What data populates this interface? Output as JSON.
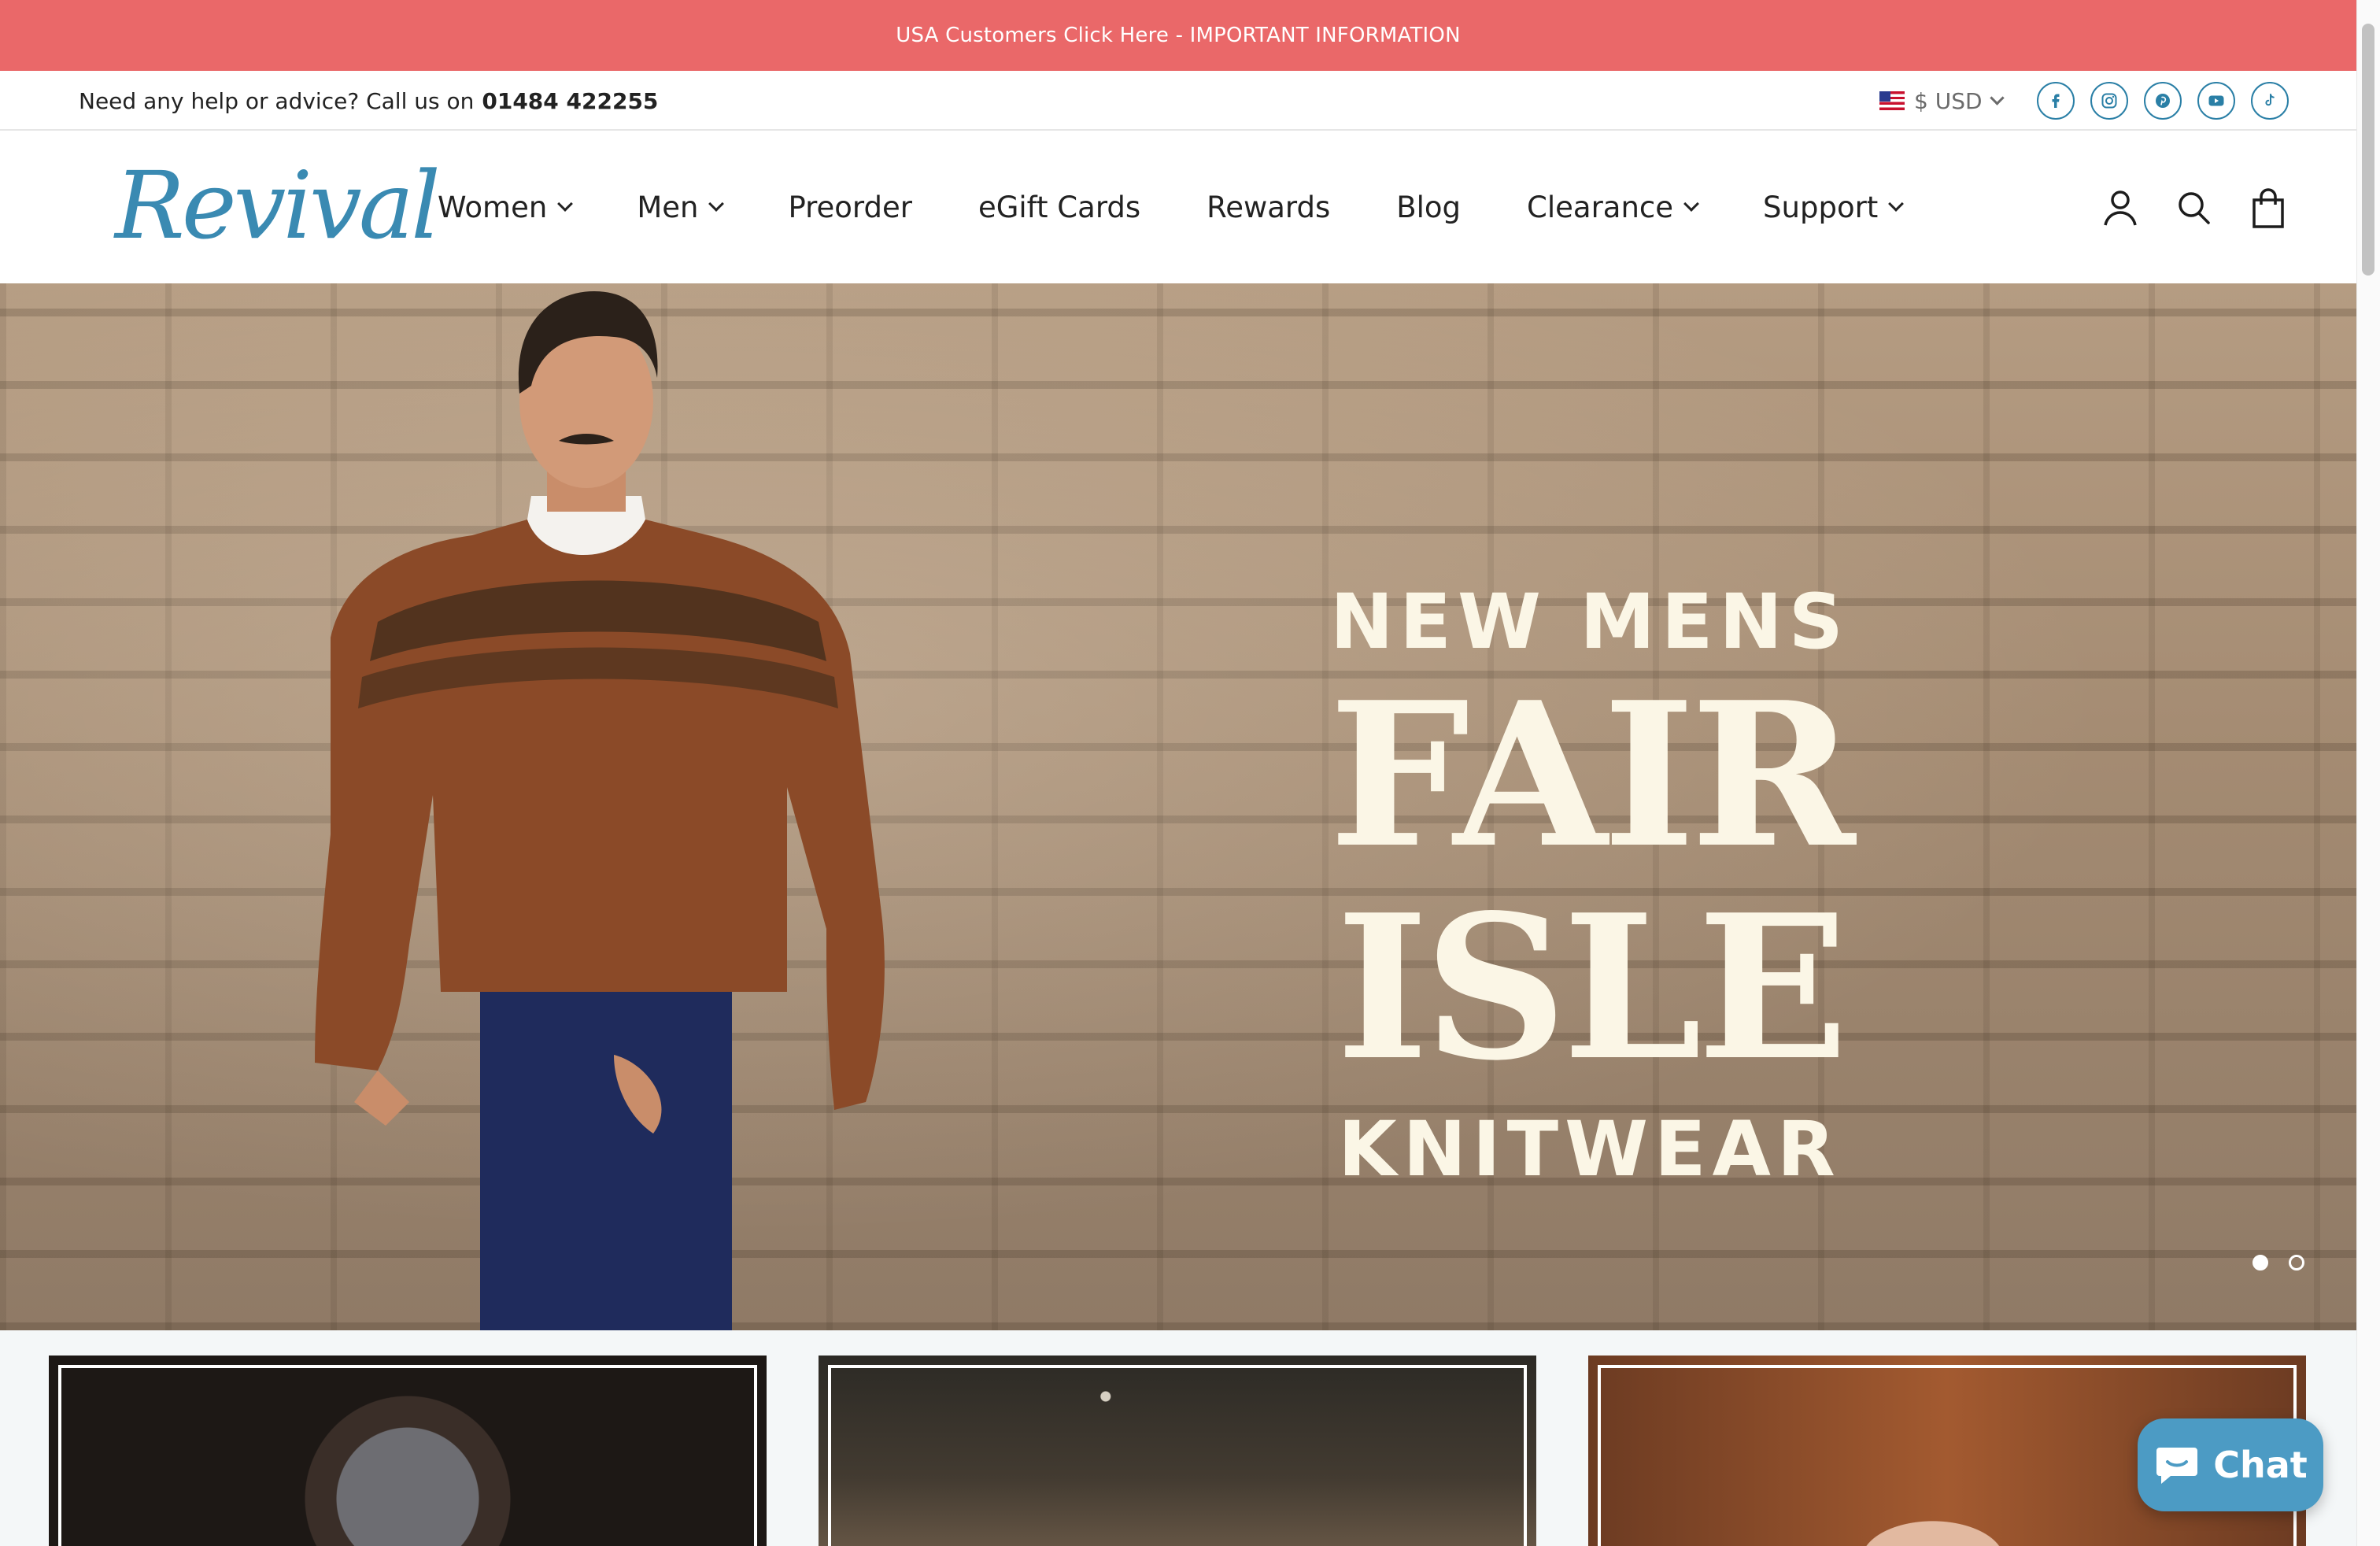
{
  "announcement": {
    "text": "USA Customers Click Here - IMPORTANT INFORMATION"
  },
  "utility_bar": {
    "help_text": "Need any help or advice? Call us on",
    "phone": "01484 422255",
    "currency": "$ USD",
    "socials": [
      "facebook-icon",
      "instagram-icon",
      "pinterest-icon",
      "youtube-icon",
      "tiktok-icon"
    ]
  },
  "header": {
    "logo": "Revival",
    "nav": [
      {
        "label": "Women",
        "dropdown": true
      },
      {
        "label": "Men",
        "dropdown": true
      },
      {
        "label": "Preorder",
        "dropdown": false
      },
      {
        "label": "eGift Cards",
        "dropdown": false
      },
      {
        "label": "Rewards",
        "dropdown": false
      },
      {
        "label": "Blog",
        "dropdown": false
      },
      {
        "label": "Clearance",
        "dropdown": true
      },
      {
        "label": "Support",
        "dropdown": true
      }
    ],
    "icons": [
      "account-icon",
      "search-icon",
      "cart-icon"
    ]
  },
  "hero": {
    "kicker": "NEW MENS",
    "title": "FAIR ISLE",
    "subtitle": "KNITWEAR",
    "slides": 2,
    "active_slide": 1
  },
  "chat": {
    "label": "Chat"
  },
  "colors": {
    "announcement_bg": "#ea6869",
    "brand_blue": "#3a8ab2",
    "chat_bg": "#4c9bc4",
    "hero_text": "#fbf6e6"
  }
}
